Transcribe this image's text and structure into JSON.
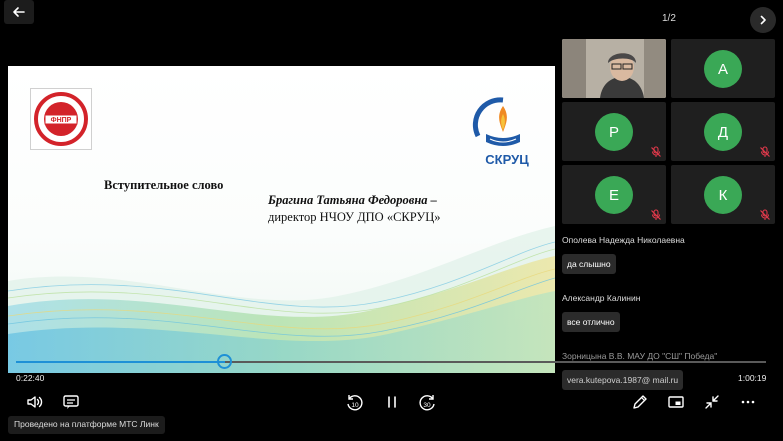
{
  "header": {
    "page_indicator": "1/2"
  },
  "slide": {
    "intro": "Вступительное слово",
    "speaker_name": "Брагина Татьяна Федоровна –",
    "speaker_role": "директор НЧОУ ДПО «СКРУЦ»",
    "logo_left_text": "ФНПР",
    "logo_right_text": "СКРУЦ"
  },
  "participants": [
    {
      "kind": "video"
    },
    {
      "kind": "avatar",
      "initial": "А",
      "muted": false
    },
    {
      "kind": "avatar",
      "initial": "Р",
      "muted": true
    },
    {
      "kind": "avatar",
      "initial": "Д",
      "muted": true
    },
    {
      "kind": "avatar",
      "initial": "Е",
      "muted": true
    },
    {
      "kind": "avatar",
      "initial": "К",
      "muted": true
    }
  ],
  "chat": [
    {
      "author": "Ополева Надежда Николаевна",
      "message": "да слышно"
    },
    {
      "author": "Александр Калинин",
      "message": "все отлично"
    },
    {
      "author": "Зорницына В.В. МАУ ДО \"СШ\" Победа\"",
      "message": "vera.kutepova.1987@ mail.ru"
    }
  ],
  "player": {
    "current_time": "0:22:40",
    "total_time": "1:00:19",
    "progress_fraction": 0.278,
    "rewind_label": "10",
    "forward_label": "30"
  },
  "footer": {
    "note": "Проведено на платформе МТС Линк"
  },
  "colors": {
    "accent": "#1e90d6",
    "avatar": "#3aa856",
    "mic_off": "#e0394b"
  }
}
